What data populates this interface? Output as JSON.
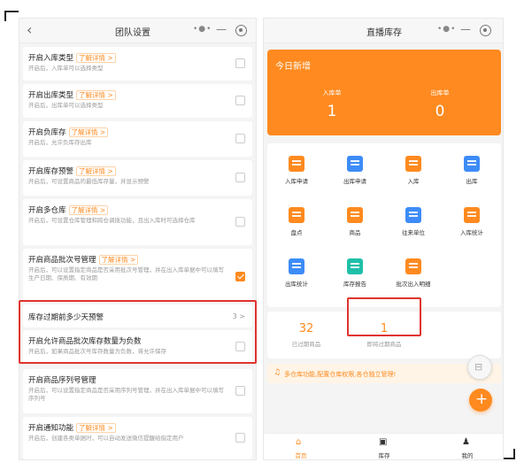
{
  "left": {
    "nav": {
      "back": "‹",
      "title": "团队设置"
    },
    "settings": [
      {
        "title": "开启入库类型",
        "link": "了解详情 >",
        "desc": "开启后，入库单可以选择类型",
        "checked": false
      },
      {
        "title": "开启出库类型",
        "link": "了解详情 >",
        "desc": "开启后，出库单可以选择类型",
        "checked": false
      },
      {
        "title": "开启负库存",
        "link": "了解详情 >",
        "desc": "开启后，允许负库存出库",
        "checked": false
      },
      {
        "title": "开启库存预警",
        "link": "了解详情 >",
        "desc": "开启后，可设置商品的最低库存量，并显示预警",
        "checked": false
      },
      {
        "title": "开启多仓库",
        "link": "了解详情 >",
        "desc": "开启后，可设置仓库管理和跨仓调拨功能，且出入库时可选择仓库",
        "checked": false
      },
      {
        "title": "开启商品批次号管理",
        "link": "了解详情 >",
        "desc": "开启后，可以设置指定商品是否采用批次号管理，并在出入库单据中可以填写生产日期、保质期、有效期",
        "checked": true
      },
      {
        "title": "库存过期前多少天预警",
        "value": "3",
        "arrow": ">"
      },
      {
        "title": "开启允许商品批次库存数量为负数",
        "desc": "开启后，如果商品批次号库存数量为负数，将允许保存",
        "checked": false
      },
      {
        "title": "开启商品序列号管理",
        "desc": "开启后，可以设置指定商品是否采用序列号管理，并在出入库单据中可以填写序列号",
        "checked": false
      },
      {
        "title": "开启通知功能",
        "link": "了解详情 >",
        "desc": "开启后，创建各类单据时，可以自动发送微信提醒给指定用户",
        "checked": false
      }
    ]
  },
  "right": {
    "nav": {
      "title": "直播库存"
    },
    "today": {
      "title": "今日新增",
      "items": [
        {
          "label": "入库单",
          "value": "1"
        },
        {
          "label": "出库单",
          "value": "0"
        }
      ]
    },
    "grid": [
      {
        "label": "入库申请",
        "icon": "inbound-request-icon",
        "color": "#ff8a1f"
      },
      {
        "label": "出库申请",
        "icon": "outbound-request-icon",
        "color": "#3d8cf7"
      },
      {
        "label": "入库",
        "icon": "inbound-icon",
        "color": "#ff8a1f"
      },
      {
        "label": "出库",
        "icon": "outbound-icon",
        "color": "#3d8cf7"
      },
      {
        "label": "盘点",
        "icon": "stocktake-icon",
        "color": "#ff8a1f"
      },
      {
        "label": "商品",
        "icon": "product-icon",
        "color": "#ff8a1f"
      },
      {
        "label": "往来单位",
        "icon": "partner-icon",
        "color": "#3d8cf7"
      },
      {
        "label": "入库统计",
        "icon": "inbound-stats-icon",
        "color": "#ff8a1f"
      },
      {
        "label": "出库统计",
        "icon": "outbound-stats-icon",
        "color": "#3d8cf7"
      },
      {
        "label": "库存报告",
        "icon": "inventory-report-icon",
        "color": "#1fbfa8"
      },
      {
        "label": "批次出入明细",
        "icon": "batch-detail-icon",
        "color": "#ff8a1f"
      }
    ],
    "stats": [
      {
        "value": "32",
        "label": "已过期商品"
      },
      {
        "value": "1",
        "label": "即将过期商品"
      }
    ],
    "notice": {
      "icon": "bell-icon",
      "text": "多仓库功能,配置仓库权限,各仓独立管理!"
    },
    "tabbar": [
      {
        "label": "首页",
        "icon": "home-icon",
        "active": true
      },
      {
        "label": "库存",
        "icon": "inventory-icon",
        "active": false
      },
      {
        "label": "我的",
        "icon": "profile-icon",
        "active": false
      }
    ]
  },
  "colors": {
    "accent": "#ff8a1f",
    "highlight": "#e0332e",
    "blue": "#3d8cf7",
    "teal": "#1fbfa8"
  }
}
